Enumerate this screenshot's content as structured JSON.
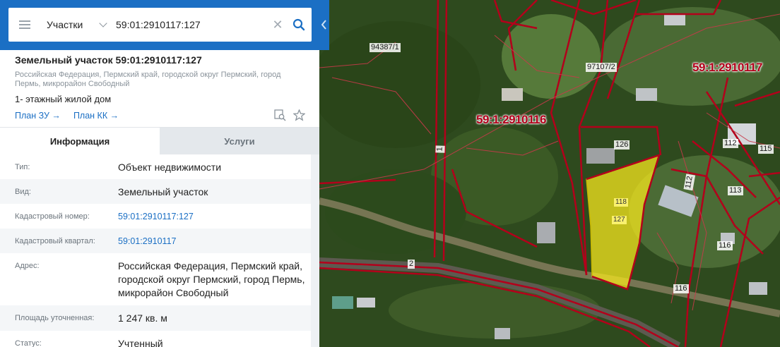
{
  "search": {
    "type_label": "Участки",
    "query": "59:01:2910117:127"
  },
  "object": {
    "title": "Земельный участок 59:01:2910117:127",
    "address_short": "Российская Федерация, Пермский край, городской округ Пермский, город Пермь, микрорайон Свободный",
    "description": "1- этажный жилой дом",
    "links": [
      "План ЗУ →",
      "План КК →"
    ]
  },
  "tabs": [
    "Информация",
    "Услуги"
  ],
  "info_rows": [
    {
      "label": "Тип:",
      "value": "Объект недвижимости",
      "link": false
    },
    {
      "label": "Вид:",
      "value": "Земельный участок",
      "link": false
    },
    {
      "label": "Кадастровый номер:",
      "value": "59:01:2910117:127",
      "link": true
    },
    {
      "label": "Кадастровый квартал:",
      "value": "59:01:2910117",
      "link": true
    },
    {
      "label": "Адрес:",
      "value": "Российская Федерация, Пермский край, городской округ Пермский, город Пермь, микрорайон Свободный",
      "link": false
    },
    {
      "label": "Площадь уточненная:",
      "value": "1 247 кв. м",
      "link": false
    },
    {
      "label": "Статус:",
      "value": "Учтенный",
      "link": false
    }
  ],
  "map": {
    "labels": {
      "parcel_94387": "94387/1",
      "parcel_97107": "97107/2",
      "block_2910116": "59:1:2910116",
      "block_2910117": "59:1:2910117",
      "p1": "1",
      "p2": "2",
      "p126": "126",
      "p118": "118",
      "p127": "127",
      "p112a": "112",
      "p112b": "112",
      "p115": "115",
      "p113": "113",
      "p116a": "116",
      "p116b": "116"
    },
    "colors": {
      "boundary": "#b3001b",
      "selected_fill": "#f5e71e",
      "accent": "#1b6fc4"
    }
  }
}
